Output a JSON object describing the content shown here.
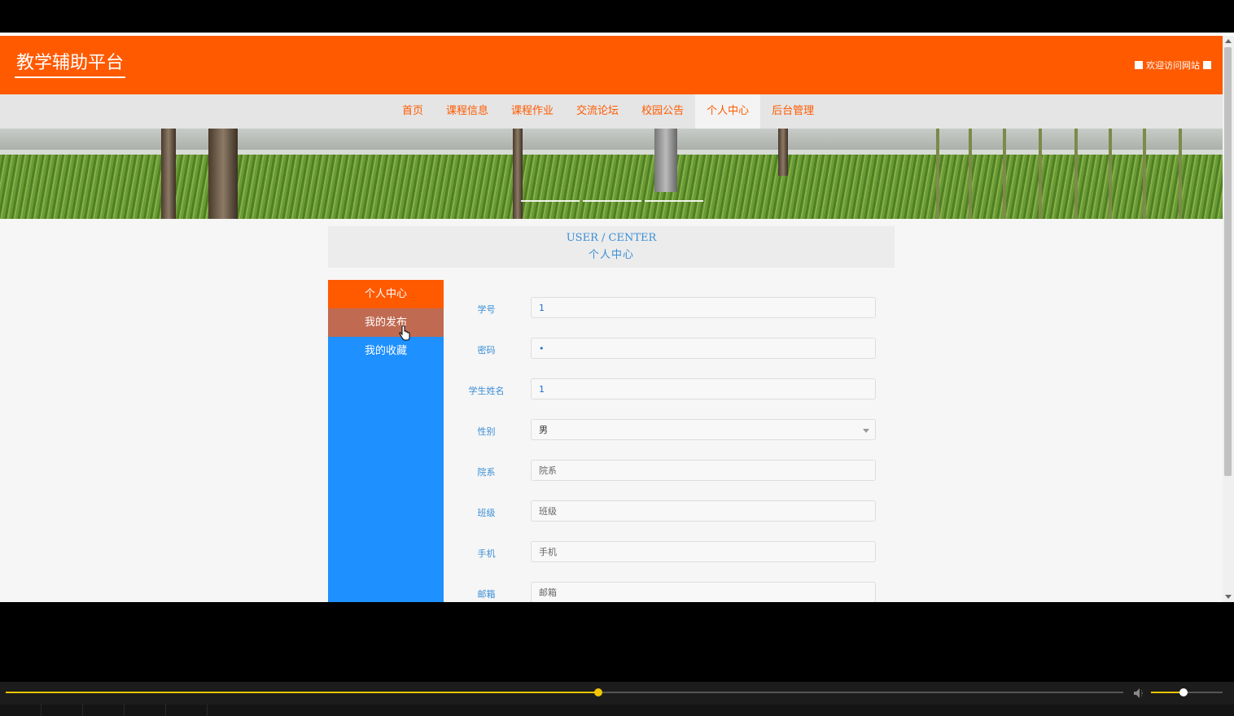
{
  "header": {
    "site_title": "教学辅助平台",
    "welcome_text": "欢迎访问网站",
    "bg_color": "#ff5a00"
  },
  "nav": {
    "items": [
      {
        "label": "首页"
      },
      {
        "label": "课程信息"
      },
      {
        "label": "课程作业"
      },
      {
        "label": "交流论坛"
      },
      {
        "label": "校园公告"
      },
      {
        "label": "个人中心",
        "active": true
      },
      {
        "label": "后台管理"
      }
    ]
  },
  "banner": {
    "slide_indicators": 3
  },
  "section": {
    "title_en": "USER / CENTER",
    "title_zh": "个人中心"
  },
  "side_menu": {
    "items": [
      {
        "label": "个人中心"
      },
      {
        "label": "我的发布"
      },
      {
        "label": "我的收藏"
      }
    ]
  },
  "form": {
    "fields": [
      {
        "label": "学号",
        "value": "1",
        "placeholder": ""
      },
      {
        "label": "密码",
        "value": "•",
        "placeholder": ""
      },
      {
        "label": "学生姓名",
        "value": "1",
        "placeholder": ""
      },
      {
        "label": "性别",
        "value": "男",
        "type": "select"
      },
      {
        "label": "院系",
        "value": "",
        "placeholder": "院系"
      },
      {
        "label": "班级",
        "value": "",
        "placeholder": "班级"
      },
      {
        "label": "手机",
        "value": "",
        "placeholder": "手机"
      },
      {
        "label": "邮箱",
        "value": "",
        "placeholder": "邮箱"
      }
    ]
  },
  "player": {
    "progress": 0.53,
    "volume": 0.45,
    "accent_color": "#f2c500"
  }
}
